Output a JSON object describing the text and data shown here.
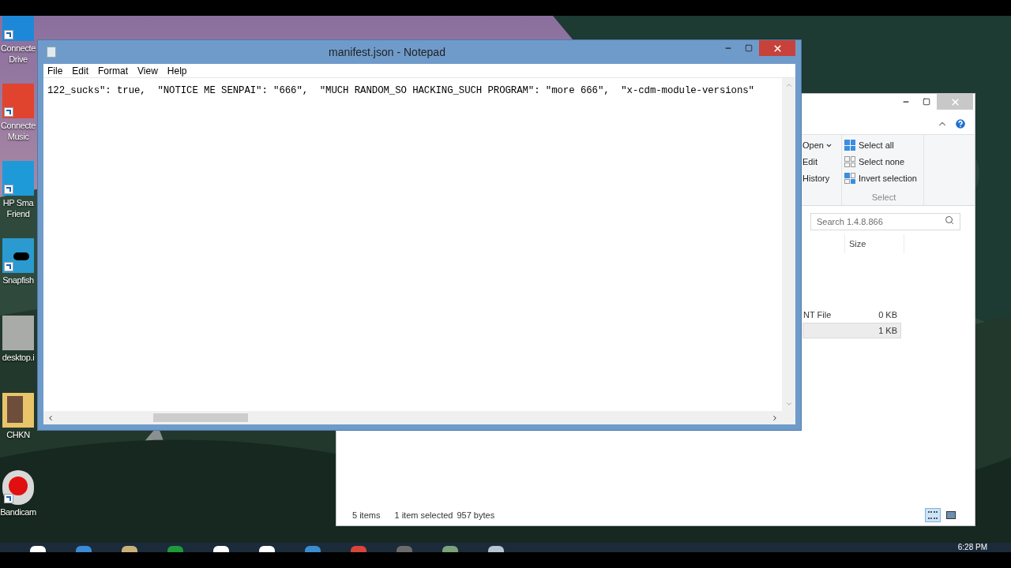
{
  "desktop_icons": [
    {
      "lines": [
        "Connecte",
        "Drive"
      ]
    },
    {
      "lines": [
        "Connecte",
        "Music"
      ]
    },
    {
      "lines": [
        "HP Sma",
        "Friend"
      ]
    },
    {
      "lines": [
        "Snapfish"
      ]
    },
    {
      "lines": [
        "desktop.i"
      ]
    },
    {
      "lines": [
        "CHKN"
      ]
    },
    {
      "lines": [
        "Bandicam"
      ]
    }
  ],
  "notepad": {
    "title": "manifest.json - Notepad",
    "menu": [
      "File",
      "Edit",
      "Format",
      "View",
      "Help"
    ],
    "text": "122_sucks\": true,  \"NOTICE ME SENPAI\": \"666\",  \"MUCH RANDOM_SO HACKING_SUCH PROGRAM\": \"more 666\",  \"x-cdm-module-versions\""
  },
  "explorer": {
    "ribbon_items": [
      {
        "label": "Open",
        "dropdown": true
      },
      {
        "label": "Edit",
        "dropdown": false
      },
      {
        "label": "History",
        "dropdown": false
      }
    ],
    "select_group": {
      "items": [
        "Select all",
        "Select none",
        "Invert selection"
      ],
      "label": "Select"
    },
    "search": {
      "placeholder": "Search 1.4.8.866"
    },
    "columns": [
      "Size"
    ],
    "rows": [
      {
        "type": "NT File",
        "size": "0 KB",
        "selected": false
      },
      {
        "size": "1 KB",
        "selected": true
      }
    ],
    "status": {
      "count": "5 items",
      "selection": "1 item selected",
      "size": "957 bytes"
    },
    "views": [
      {
        "kind": "details",
        "selected": true
      },
      {
        "kind": "large_icons",
        "selected": false
      }
    ]
  },
  "taskbar": {
    "clock": "6:28 PM"
  }
}
